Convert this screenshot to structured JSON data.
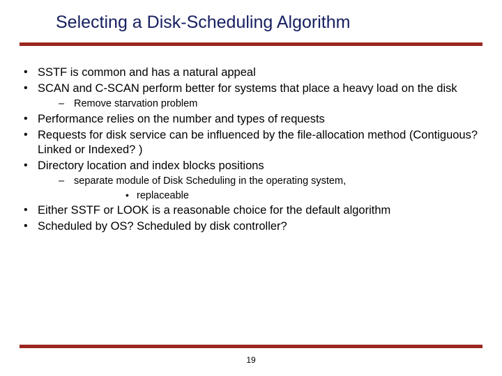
{
  "title": "Selecting a Disk-Scheduling Algorithm",
  "bullets": {
    "b1": "SSTF is common and has a natural appeal",
    "b2": "SCAN and C-SCAN perform better for systems that place a heavy load on the disk",
    "b2_s1": "Remove starvation problem",
    "b3": "Performance relies on the number and types of requests",
    "b4": "Requests for disk service can be influenced by the file-allocation method (Contiguous? Linked or Indexed? )",
    "b5": "Directory location and index blocks positions",
    "b5_s1": "separate module of Disk Scheduling in the operating system,",
    "b5_s1_t1": "replaceable",
    "b6": "Either SSTF or LOOK is a reasonable choice for the default algorithm",
    "b7": "Scheduled by OS? Scheduled by disk controller?"
  },
  "page_number": "19"
}
